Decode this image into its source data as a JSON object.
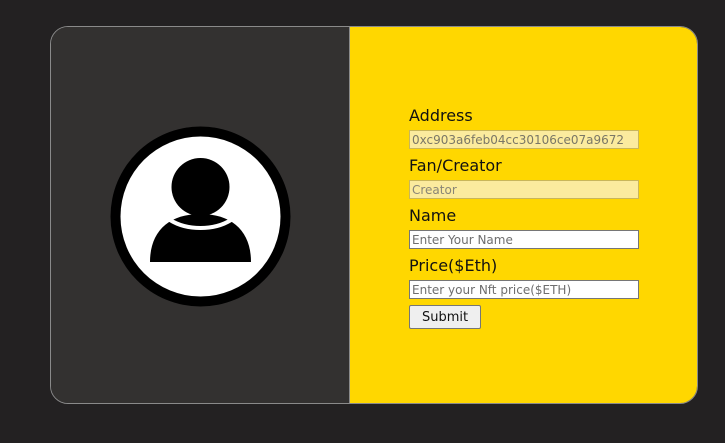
{
  "colors": {
    "page_background": "#232122",
    "left_panel": "#333130",
    "right_panel": "#ffd700"
  },
  "avatar": {
    "icon": "user-avatar-icon"
  },
  "form": {
    "address": {
      "label": "Address",
      "value": "0xc903a6feb04cc30106ce07a9672"
    },
    "role": {
      "label": "Fan/Creator",
      "placeholder": "Creator"
    },
    "name": {
      "label": "Name",
      "placeholder": "Enter Your Name"
    },
    "price": {
      "label": "Price($Eth)",
      "placeholder": "Enter your Nft price($ETH)"
    },
    "submit_label": "Submit"
  }
}
